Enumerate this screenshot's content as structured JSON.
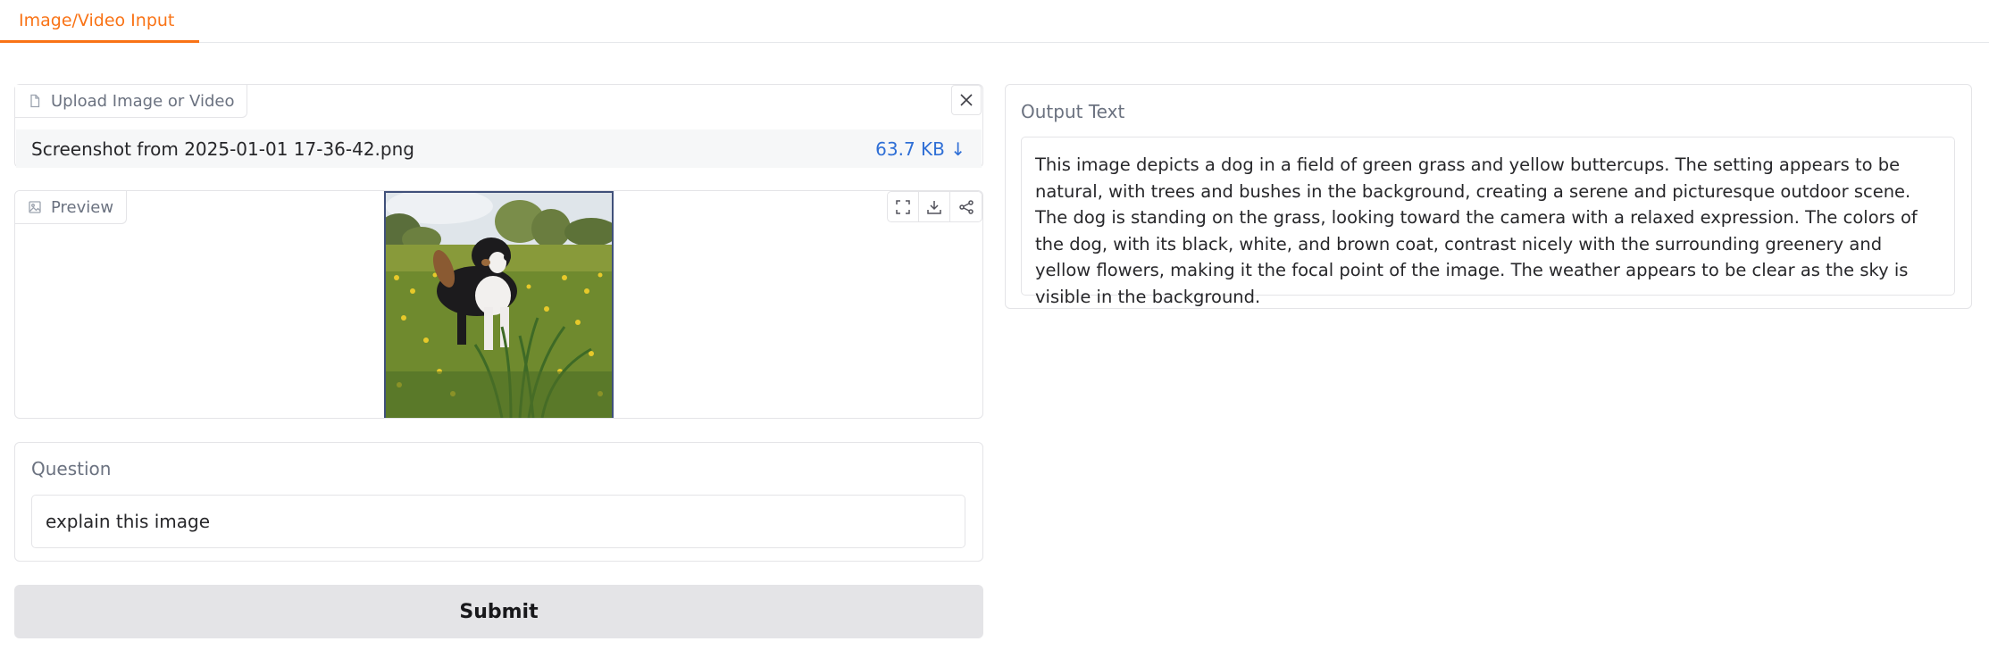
{
  "tabs": [
    {
      "label": "Image/Video Input",
      "active": true
    }
  ],
  "upload": {
    "label": "Upload Image or Video",
    "file_name": "Screenshot from 2025-01-01 17-36-42.png",
    "file_size": "63.7 KB ↓"
  },
  "preview": {
    "label": "Preview",
    "image_subject": "dog in field of green grass and yellow flowers"
  },
  "question": {
    "label": "Question",
    "value": "explain this image"
  },
  "submit": {
    "label": "Submit"
  },
  "output": {
    "label": "Output Text",
    "text": "This image depicts a dog in a field of green grass and yellow buttercups. The setting appears to be natural, with trees and bushes in the background, creating a serene and picturesque outdoor scene. The dog is standing on the grass, looking toward the camera with a relaxed expression. The colors of the dog, with its black, white, and brown coat, contrast nicely with the surrounding greenery and yellow flowers, making it the focal point of the image. The weather appears to be clear as the sky is visible in the background."
  },
  "colors": {
    "accent": "#f97316",
    "link": "#2f6fd6",
    "button_bg": "#e4e4e7"
  }
}
